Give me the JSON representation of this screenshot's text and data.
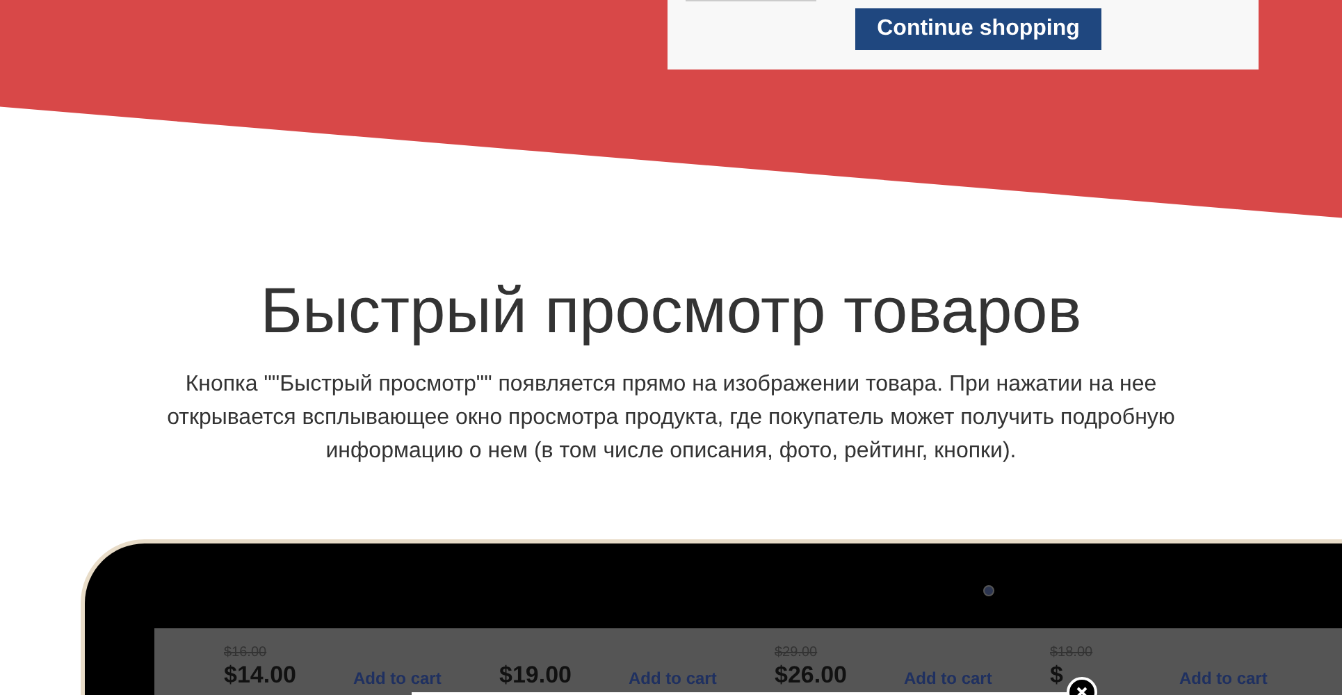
{
  "cart_popup": {
    "continue_button": "Continue shopping"
  },
  "section": {
    "title": "Быстрый просмотр товаров",
    "description": "Кнопка \"\"Быстрый просмотр\"\" появляется прямо на изображении товара. При нажатии на нее открывается всплывающее окно просмотра продукта, где покупатель может получить подробную информацию о нем (в том числе описания, фото, рейтинг, кнопки)."
  },
  "products": [
    {
      "old_price": "$16.00",
      "price": "$14.00",
      "add_to_cart": "Add to cart"
    },
    {
      "price": "$19.00",
      "add_to_cart": "Add to cart"
    },
    {
      "old_price": "$29.00",
      "price": "$26.00",
      "add_to_cart": "Add to cart"
    },
    {
      "old_price": "$18.00",
      "price": "$",
      "add_to_cart": "Add to cart"
    }
  ]
}
